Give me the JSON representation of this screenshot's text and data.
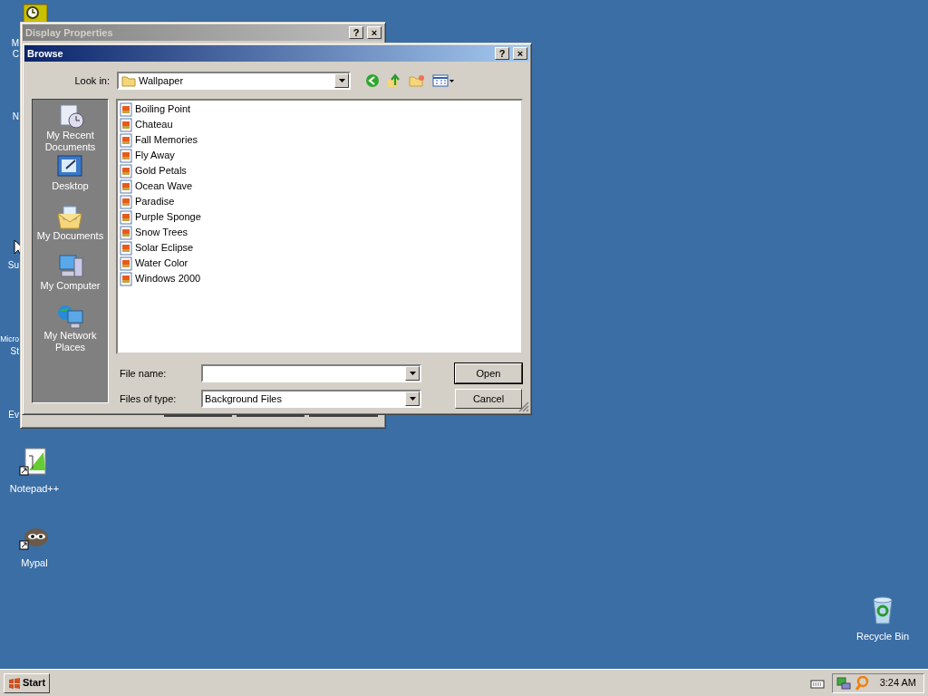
{
  "desktop": {
    "partial_labels": [
      "M",
      "C",
      "N",
      "Su",
      "Micro",
      "St",
      "Ev"
    ],
    "icons": [
      {
        "label": "Notepad++"
      },
      {
        "label": "Mypal"
      },
      {
        "label": "Recycle Bin"
      }
    ]
  },
  "background_window": {
    "title": "Display Properties",
    "active": false,
    "controls": [
      "?",
      "×"
    ]
  },
  "dialog": {
    "title": "Browse",
    "active": true,
    "controls": [
      "?",
      "×"
    ],
    "look_in": {
      "label": "Look in:",
      "value": "Wallpaper"
    },
    "places": [
      {
        "label": "My Recent Documents",
        "selected": false
      },
      {
        "label": "Desktop",
        "selected": false
      },
      {
        "label": "My Documents",
        "selected": false
      },
      {
        "label": "My Computer",
        "selected": false
      },
      {
        "label": "My Network Places",
        "selected": false
      }
    ],
    "files": [
      {
        "name": "Boiling Point",
        "selected": false
      },
      {
        "name": "Chateau",
        "selected": false
      },
      {
        "name": "Fall Memories",
        "selected": false
      },
      {
        "name": "Fly Away",
        "selected": false
      },
      {
        "name": "Gold Petals",
        "selected": false
      },
      {
        "name": "Ocean Wave",
        "selected": false
      },
      {
        "name": "Paradise",
        "selected": false
      },
      {
        "name": "Purple Sponge",
        "selected": false
      },
      {
        "name": "Snow Trees",
        "selected": false
      },
      {
        "name": "Solar Eclipse",
        "selected": false
      },
      {
        "name": "Water Color",
        "selected": false
      },
      {
        "name": "Windows 2000",
        "selected": false
      }
    ],
    "file_name": {
      "label": "File name:"
    },
    "file_type": {
      "label": "Files of type:",
      "value": "Background Files"
    },
    "buttons": [
      {
        "label": "Open",
        "default": true
      },
      {
        "label": "Cancel",
        "default": false
      }
    ]
  },
  "taskbar": {
    "start": "Start",
    "clock": "3:24 AM"
  }
}
